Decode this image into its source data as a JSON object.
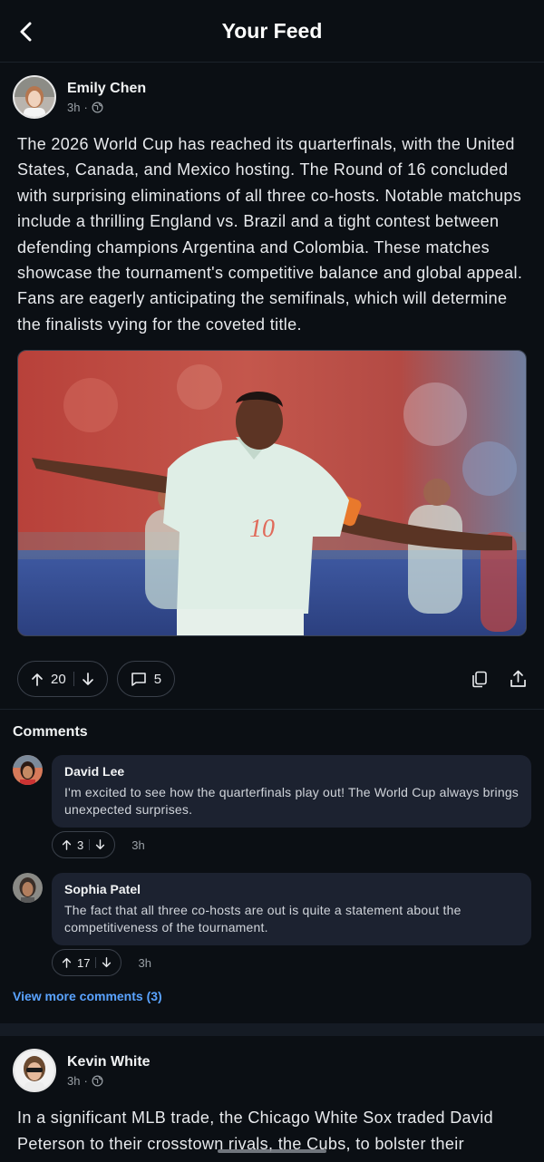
{
  "header": {
    "title": "Your Feed"
  },
  "posts": [
    {
      "author": "Emily Chen",
      "time": "3h",
      "text": "The 2026 World Cup has reached its quarterfinals, with the United States, Canada, and Mexico hosting. The Round of 16 concluded with surprising eliminations of all three co-hosts. Notable matchups include a thrilling England vs. Brazil and a tight contest between defending champions Argentina and Colombia. These matches showcase the tournament's competitive balance and global appeal. Fans are eagerly anticipating the semifinals, which will determine the finalists vying for the coveted title.",
      "image_jersey_number": "10",
      "upvotes": "20",
      "comment_count": "5"
    },
    {
      "author": "Kevin White",
      "time": "3h",
      "text": "In a significant MLB trade, the Chicago White Sox traded David Peterson to their crosstown rivals, the Cubs, to bolster their"
    }
  ],
  "comments": {
    "title": "Comments",
    "items": [
      {
        "author": "David Lee",
        "text": "I'm excited to see how the quarterfinals play out! The World Cup always brings unexpected surprises.",
        "upvotes": "3",
        "time": "3h"
      },
      {
        "author": "Sophia Patel",
        "text": "The fact that all three co-hosts are out is quite a statement about the competitiveness of the tournament.",
        "upvotes": "17",
        "time": "3h"
      }
    ],
    "view_more": "View more comments (3)"
  },
  "colors": {
    "accent": "#5aa3ff",
    "background": "#0b0f14",
    "bubble": "#1c2230"
  }
}
